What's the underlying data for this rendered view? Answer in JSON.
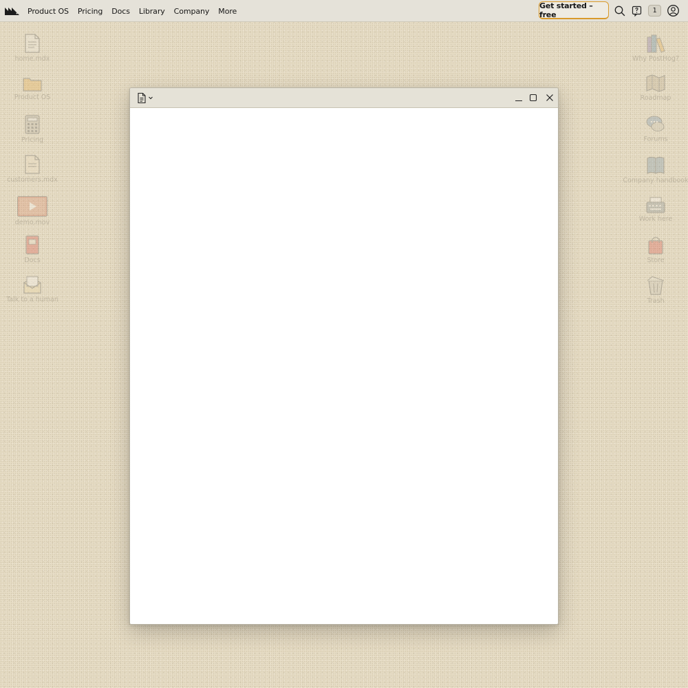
{
  "nav": {
    "items": [
      "Product OS",
      "Pricing",
      "Docs",
      "Library",
      "Company",
      "More"
    ],
    "cta_label": "Get started – free",
    "notification_count": "1"
  },
  "desktop": {
    "left": [
      {
        "label": "home.mdx",
        "icon": "document-icon"
      },
      {
        "label": "Product OS",
        "icon": "folder-icon"
      },
      {
        "label": "Pricing",
        "icon": "calculator-icon"
      },
      {
        "label": "customers.mdx",
        "icon": "document-icon"
      },
      {
        "label": "demo.mov",
        "icon": "video-icon"
      },
      {
        "label": "Docs",
        "icon": "book-icon"
      },
      {
        "label": "Talk to a human",
        "icon": "envelope-icon"
      }
    ],
    "right": [
      {
        "label": "Why PostHog?",
        "icon": "books-icon"
      },
      {
        "label": "Roadmap",
        "icon": "map-icon"
      },
      {
        "label": "Forums",
        "icon": "chat-icon"
      },
      {
        "label": "Company handbook",
        "icon": "handbook-icon"
      },
      {
        "label": "Work here",
        "icon": "typewriter-icon"
      },
      {
        "label": "Store",
        "icon": "shopping-bag-icon"
      },
      {
        "label": "Trash",
        "icon": "trash-icon"
      }
    ]
  },
  "colors": {
    "background": "#e6dcc4",
    "cta_border": "#d99a2b",
    "titlebar": "#e5e2d7"
  }
}
